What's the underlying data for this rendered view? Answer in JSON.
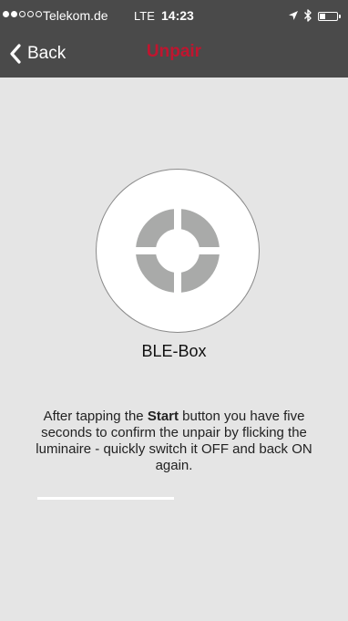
{
  "status_bar": {
    "signal_strength": 2,
    "signal_total": 5,
    "carrier": "Telekom.de",
    "network": "LTE",
    "time": "14:23",
    "location_icon": "location-arrow-icon",
    "bluetooth_icon": "bluetooth-icon",
    "battery_level": 0.3
  },
  "nav": {
    "back_label": "Back",
    "title": "Unpair",
    "title_color": "#c0152f"
  },
  "device": {
    "name": "BLE-Box",
    "logo_icon": "segmented-ring-icon",
    "logo_color": "#a9aaa9"
  },
  "instructions": {
    "before": "After tapping the ",
    "bold": "Start",
    "after": " button you have five seconds to confirm the unpair by flicking the luminaire - quickly switch it OFF and back ON again."
  },
  "progress": {
    "value": 0.5
  }
}
